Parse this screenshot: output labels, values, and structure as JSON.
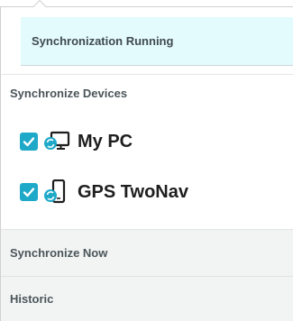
{
  "status": {
    "label": "Synchronization Running"
  },
  "sync_devices": {
    "title": "Synchronize Devices",
    "devices": [
      {
        "label": "My PC",
        "checked": true,
        "icon": "pc-sync-icon"
      },
      {
        "label": "GPS TwoNav",
        "checked": true,
        "icon": "phone-sync-icon"
      }
    ]
  },
  "actions": {
    "sync_now": "Synchronize Now",
    "historic": "Historic"
  },
  "colors": {
    "accent": "#1ea9c9",
    "status_bg": "#e4fbfd",
    "row_bg": "#f2f4f4"
  }
}
